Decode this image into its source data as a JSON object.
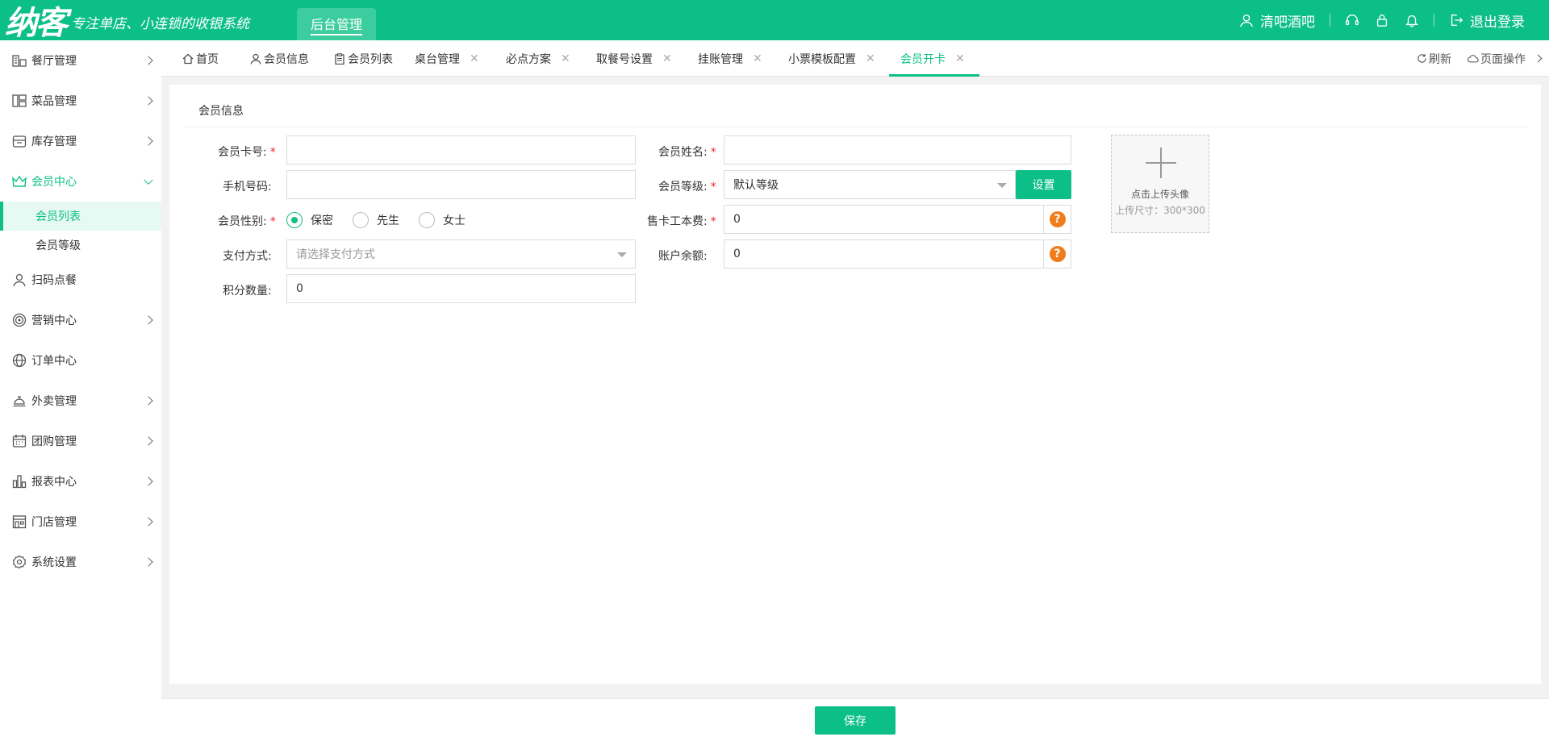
{
  "header": {
    "logo_text": "纳客",
    "slogan": "专注单店、小连锁的收银系统",
    "admin_tab": "后台管理",
    "user_name": "清吧酒吧",
    "logout": "退出登录"
  },
  "sidebar": {
    "items": [
      {
        "label": "餐厅管理",
        "icon": "restaurant-icon"
      },
      {
        "label": "菜品管理",
        "icon": "dishes-icon"
      },
      {
        "label": "库存管理",
        "icon": "inventory-icon"
      },
      {
        "label": "会员中心",
        "icon": "crown-icon"
      },
      {
        "label": "扫码点餐",
        "icon": "user-icon"
      },
      {
        "label": "营销中心",
        "icon": "target-icon"
      },
      {
        "label": "订单中心",
        "icon": "globe-icon"
      },
      {
        "label": "外卖管理",
        "icon": "bell-service-icon"
      },
      {
        "label": "团购管理",
        "icon": "calendar-icon"
      },
      {
        "label": "报表中心",
        "icon": "bar-chart-icon"
      },
      {
        "label": "门店管理",
        "icon": "store-icon"
      },
      {
        "label": "系统设置",
        "icon": "gear-icon"
      }
    ],
    "sub_items": [
      {
        "label": "会员列表"
      },
      {
        "label": "会员等级"
      }
    ]
  },
  "tabs": {
    "items": [
      {
        "label": "首页"
      },
      {
        "label": "会员信息"
      },
      {
        "label": "会员列表"
      },
      {
        "label": "桌台管理"
      },
      {
        "label": "必点方案"
      },
      {
        "label": "取餐号设置"
      },
      {
        "label": "挂账管理"
      },
      {
        "label": "小票模板配置"
      },
      {
        "label": "会员开卡"
      }
    ],
    "close_glyph": "✕",
    "refresh": "刷新",
    "page_ops": "页面操作"
  },
  "form": {
    "section_title": "会员信息",
    "required_mark": "*",
    "card_no_label": "会员卡号:",
    "card_no_value": "",
    "name_label": "会员姓名:",
    "name_value": "",
    "phone_label": "手机号码:",
    "phone_value": "",
    "level_label": "会员等级:",
    "level_value": "默认等级",
    "level_setting_button": "设置",
    "gender_label": "会员性别:",
    "gender_options": [
      "保密",
      "先生",
      "女士"
    ],
    "fee_label": "售卡工本费:",
    "fee_value": "0",
    "pay_label": "支付方式:",
    "pay_placeholder": "请选择支付方式",
    "balance_label": "账户余额:",
    "balance_value": "0",
    "points_label": "积分数量:",
    "points_value": "0",
    "help_glyph": "?",
    "upload_text": "点击上传头像",
    "upload_size": "上传尺寸：300*300"
  },
  "footer": {
    "save_label": "保存"
  },
  "colors": {
    "brand": "#0cbf86",
    "required": "#f5222d",
    "help": "#f07c1a"
  }
}
